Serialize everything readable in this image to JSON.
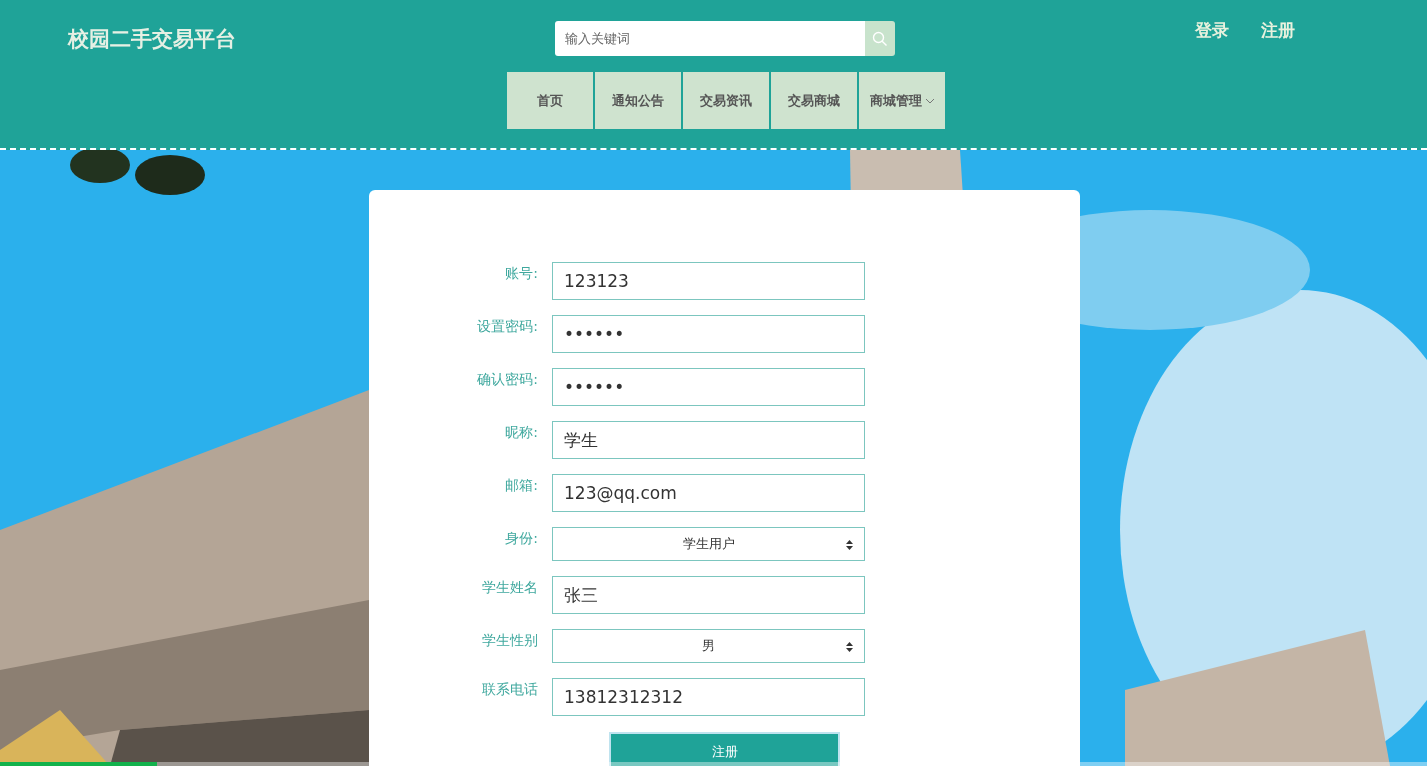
{
  "header": {
    "site_title": "校园二手交易平台",
    "search": {
      "placeholder": "输入关键词"
    },
    "auth_links": [
      "登录",
      "注册"
    ]
  },
  "nav": [
    {
      "label": "首页",
      "dropdown": false
    },
    {
      "label": "通知公告",
      "dropdown": false
    },
    {
      "label": "交易资讯",
      "dropdown": false
    },
    {
      "label": "交易商城",
      "dropdown": false
    },
    {
      "label": "商城管理",
      "dropdown": true
    }
  ],
  "form": {
    "fields": [
      {
        "label": "账号:",
        "kind": "text",
        "value": "123123"
      },
      {
        "label": "设置密码:",
        "kind": "text",
        "value": "••••••"
      },
      {
        "label": "确认密码:",
        "kind": "text",
        "value": "••••••"
      },
      {
        "label": "昵称:",
        "kind": "text",
        "value": "学生"
      },
      {
        "label": "邮箱:",
        "kind": "text",
        "value": "123@qq.com"
      },
      {
        "label": "身份:",
        "kind": "select",
        "value": "学生用户"
      },
      {
        "label": "学生姓名",
        "kind": "text",
        "value": "张三"
      },
      {
        "label": "学生性别",
        "kind": "select",
        "value": "男"
      },
      {
        "label": "联系电话",
        "kind": "text",
        "value": "13812312312"
      }
    ],
    "submit": "注册"
  },
  "video_progress": {
    "level": 0.11
  }
}
